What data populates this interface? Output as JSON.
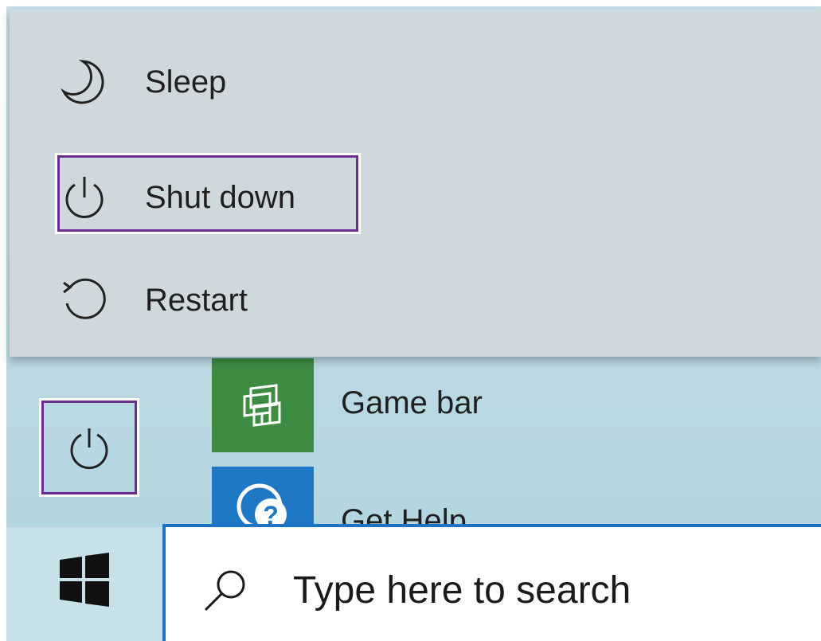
{
  "power_menu": {
    "items": [
      {
        "label": "Sleep",
        "icon": "moon-icon"
      },
      {
        "label": "Shut down",
        "icon": "power-icon"
      },
      {
        "label": "Restart",
        "icon": "restart-icon"
      }
    ]
  },
  "power_button": {
    "icon": "power-icon"
  },
  "tiles": [
    {
      "label": "Game bar",
      "icon": "game-bar-icon",
      "color": "#3e8b42"
    },
    {
      "label": "Get Help",
      "icon": "get-help-icon",
      "color": "#1f78c4"
    }
  ],
  "taskbar": {
    "start_icon": "windows-logo-icon",
    "search": {
      "placeholder": "Type here to search",
      "icon": "search-icon"
    }
  },
  "colors": {
    "highlight": "#6b2d8f",
    "taskbar_accent": "#1f73c4"
  }
}
